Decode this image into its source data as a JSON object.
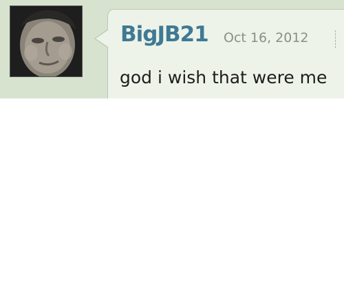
{
  "post": {
    "username": "BigJB21",
    "date": "Oct 16, 2012",
    "message": "god i wish that were me",
    "avatar_icon": "user-avatar-photo"
  },
  "colors": {
    "background": "#d7e3cf",
    "bubble": "#eef3e9",
    "username": "#3f7a94",
    "date": "#8a8f86"
  }
}
